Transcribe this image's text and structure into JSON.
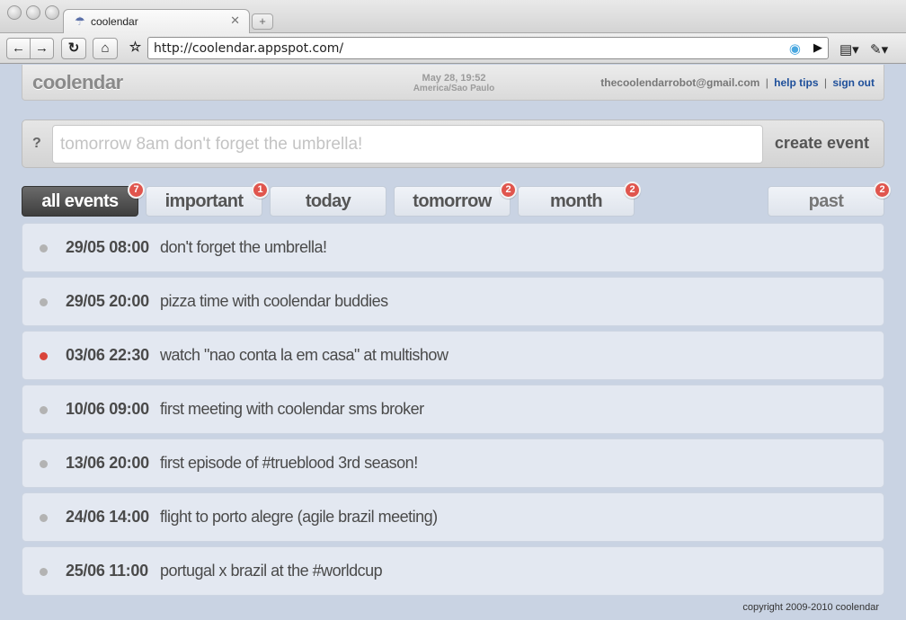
{
  "browser": {
    "tab_title": "coolendar",
    "tab_favicon": "☂",
    "tab_close": "✕",
    "new_tab": "+",
    "url": "http://coolendar.appspot.com/",
    "icons": [
      "back-icon",
      "forward-icon",
      "reload-icon",
      "home-icon",
      "bookmark-star-icon",
      "feed-icon",
      "play-icon",
      "page-menu-icon",
      "wrench-icon"
    ]
  },
  "header": {
    "logo": "coolendar",
    "date": "May 28, 19:52",
    "timezone": "America/Sao Paulo",
    "user_email": "thecoolendarrobot@gmail.com",
    "separator": "|",
    "help_link": "help tips",
    "signout_link": "sign out"
  },
  "create": {
    "help_label": "?",
    "placeholder": "tomorrow 8am don't forget the umbrella!",
    "button_label": "create event"
  },
  "filters": {
    "all": {
      "label": "all events",
      "count": "7"
    },
    "important": {
      "label": "important",
      "count": "1"
    },
    "today": {
      "label": "today"
    },
    "tomorrow": {
      "label": "tomorrow",
      "count": "2"
    },
    "month": {
      "label": "month",
      "count": "2"
    },
    "past": {
      "label": "past",
      "count": "2"
    }
  },
  "events": [
    {
      "date": "29/05 08:00",
      "text": "don't forget the umbrella!",
      "important": false
    },
    {
      "date": "29/05 20:00",
      "text": "pizza time with coolendar buddies",
      "important": false
    },
    {
      "date": "03/06 22:30",
      "text": "watch \"nao conta la em casa\" at multishow",
      "important": true
    },
    {
      "date": "10/06 09:00",
      "text": "first meeting with coolendar sms broker",
      "important": false
    },
    {
      "date": "13/06 20:00",
      "text": "first episode of #trueblood 3rd season!",
      "important": false
    },
    {
      "date": "24/06 14:00",
      "text": "flight to porto alegre (agile brazil meeting)",
      "important": false
    },
    {
      "date": "25/06 11:00",
      "text": "portugal x brazil at the #worldcup",
      "important": false
    }
  ],
  "colors": {
    "important_dot": "#d9443a",
    "normal_dot": "#b3b3b3"
  },
  "footer": {
    "copyright": "copyright 2009-2010 coolendar"
  }
}
